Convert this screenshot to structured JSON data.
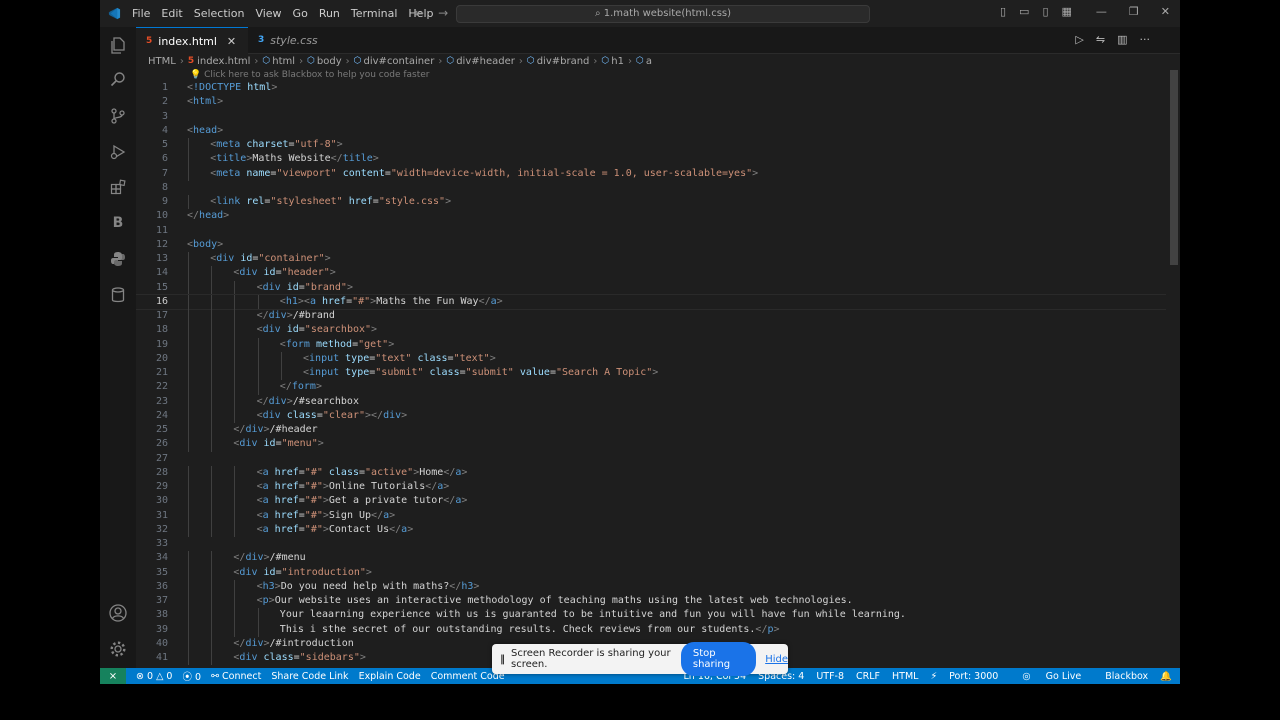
{
  "menus": [
    "File",
    "Edit",
    "Selection",
    "View",
    "Go",
    "Run",
    "Terminal",
    "Help"
  ],
  "search": {
    "text": "1.math website(html.css)"
  },
  "tabs": [
    {
      "label": "index.html",
      "icon": "html-file-icon",
      "active": true
    },
    {
      "label": "style.css",
      "icon": "css-file-icon",
      "active": false
    }
  ],
  "breadcrumb": [
    "HTML",
    "index.html",
    "html",
    "body",
    "div#container",
    "div#header",
    "div#brand",
    "h1",
    "a"
  ],
  "hint": "Click here to ask Blackbox to help you code faster",
  "activity_icons": [
    "explorer-icon",
    "search-icon",
    "source-control-icon",
    "run-debug-icon",
    "extensions-icon",
    "blackbox-icon",
    "python-icon",
    "database-icon",
    "account-icon",
    "settings-gear-icon"
  ],
  "activity_letter_b": "B",
  "code": [
    {
      "n": "1",
      "i": 0,
      "t": [
        [
          "br",
          "<"
        ],
        [
          "tag",
          "!DOCTYPE "
        ],
        [
          "at",
          "html"
        ],
        [
          "br",
          ">"
        ]
      ]
    },
    {
      "n": "2",
      "i": 0,
      "t": [
        [
          "br",
          "<"
        ],
        [
          "tag",
          "html"
        ],
        [
          "br",
          ">"
        ]
      ]
    },
    {
      "n": "3",
      "i": 0,
      "t": []
    },
    {
      "n": "4",
      "i": 0,
      "t": [
        [
          "br",
          "<"
        ],
        [
          "tag",
          "head"
        ],
        [
          "br",
          ">"
        ]
      ]
    },
    {
      "n": "5",
      "i": 1,
      "t": [
        [
          "br",
          "<"
        ],
        [
          "tag",
          "meta "
        ],
        [
          "at",
          "charset"
        ],
        [
          "tx",
          "="
        ],
        [
          "val",
          "\"utf-8\""
        ],
        [
          "br",
          ">"
        ]
      ]
    },
    {
      "n": "6",
      "i": 1,
      "t": [
        [
          "br",
          "<"
        ],
        [
          "tag",
          "title"
        ],
        [
          "br",
          ">"
        ],
        [
          "tx",
          "Maths Website"
        ],
        [
          "br",
          "</"
        ],
        [
          "tag",
          "title"
        ],
        [
          "br",
          ">"
        ]
      ]
    },
    {
      "n": "7",
      "i": 1,
      "t": [
        [
          "br",
          "<"
        ],
        [
          "tag",
          "meta "
        ],
        [
          "at",
          "name"
        ],
        [
          "tx",
          "="
        ],
        [
          "val",
          "\"viewport\""
        ],
        [
          "tx",
          " "
        ],
        [
          "at",
          "content"
        ],
        [
          "tx",
          "="
        ],
        [
          "val",
          "\"width=device-width, initial-scale = 1.0, user-scalable=yes\""
        ],
        [
          "br",
          ">"
        ]
      ]
    },
    {
      "n": "8",
      "i": 0,
      "t": []
    },
    {
      "n": "9",
      "i": 1,
      "t": [
        [
          "br",
          "<"
        ],
        [
          "tag",
          "link "
        ],
        [
          "at",
          "rel"
        ],
        [
          "tx",
          "="
        ],
        [
          "val",
          "\"stylesheet\""
        ],
        [
          "tx",
          " "
        ],
        [
          "at",
          "href"
        ],
        [
          "tx",
          "="
        ],
        [
          "val",
          "\"style.css\""
        ],
        [
          "br",
          ">"
        ]
      ]
    },
    {
      "n": "10",
      "i": 0,
      "t": [
        [
          "br",
          "</"
        ],
        [
          "tag",
          "head"
        ],
        [
          "br",
          ">"
        ]
      ]
    },
    {
      "n": "11",
      "i": 0,
      "t": []
    },
    {
      "n": "12",
      "i": 0,
      "t": [
        [
          "br",
          "<"
        ],
        [
          "tag",
          "body"
        ],
        [
          "br",
          ">"
        ]
      ]
    },
    {
      "n": "13",
      "i": 1,
      "t": [
        [
          "br",
          "<"
        ],
        [
          "tag",
          "div "
        ],
        [
          "at",
          "id"
        ],
        [
          "tx",
          "="
        ],
        [
          "val",
          "\"container\""
        ],
        [
          "br",
          ">"
        ]
      ]
    },
    {
      "n": "14",
      "i": 2,
      "t": [
        [
          "br",
          "<"
        ],
        [
          "tag",
          "div "
        ],
        [
          "at",
          "id"
        ],
        [
          "tx",
          "="
        ],
        [
          "val",
          "\"header\""
        ],
        [
          "br",
          ">"
        ]
      ]
    },
    {
      "n": "15",
      "i": 3,
      "t": [
        [
          "br",
          "<"
        ],
        [
          "tag",
          "div "
        ],
        [
          "at",
          "id"
        ],
        [
          "tx",
          "="
        ],
        [
          "val",
          "\"brand\""
        ],
        [
          "br",
          ">"
        ]
      ]
    },
    {
      "n": "16",
      "i": 4,
      "cur": true,
      "t": [
        [
          "br",
          "<"
        ],
        [
          "tag",
          "h1"
        ],
        [
          "br",
          ">"
        ],
        [
          "br",
          "<"
        ],
        [
          "tag",
          "a "
        ],
        [
          "at",
          "href"
        ],
        [
          "tx",
          "="
        ],
        [
          "val",
          "\"#\""
        ],
        [
          "br",
          ">"
        ],
        [
          "tx",
          "Maths the Fun Way"
        ],
        [
          "br",
          "</"
        ],
        [
          "tag",
          "a"
        ],
        [
          "br",
          ">"
        ]
      ]
    },
    {
      "n": "17",
      "i": 3,
      "t": [
        [
          "br",
          "</"
        ],
        [
          "tag",
          "div"
        ],
        [
          "br",
          ">"
        ],
        [
          "tx",
          "/#brand"
        ]
      ]
    },
    {
      "n": "18",
      "i": 3,
      "t": [
        [
          "br",
          "<"
        ],
        [
          "tag",
          "div "
        ],
        [
          "at",
          "id"
        ],
        [
          "tx",
          "="
        ],
        [
          "val",
          "\"searchbox\""
        ],
        [
          "br",
          ">"
        ]
      ]
    },
    {
      "n": "19",
      "i": 4,
      "t": [
        [
          "br",
          "<"
        ],
        [
          "tag",
          "form "
        ],
        [
          "at",
          "method"
        ],
        [
          "tx",
          "="
        ],
        [
          "val",
          "\"get\""
        ],
        [
          "br",
          ">"
        ]
      ]
    },
    {
      "n": "20",
      "i": 5,
      "t": [
        [
          "br",
          "<"
        ],
        [
          "tag",
          "input "
        ],
        [
          "at",
          "type"
        ],
        [
          "tx",
          "="
        ],
        [
          "val",
          "\"text\""
        ],
        [
          "tx",
          " "
        ],
        [
          "at",
          "class"
        ],
        [
          "tx",
          "="
        ],
        [
          "val",
          "\"text\""
        ],
        [
          "br",
          ">"
        ]
      ]
    },
    {
      "n": "21",
      "i": 5,
      "t": [
        [
          "br",
          "<"
        ],
        [
          "tag",
          "input "
        ],
        [
          "at",
          "type"
        ],
        [
          "tx",
          "="
        ],
        [
          "val",
          "\"submit\""
        ],
        [
          "tx",
          " "
        ],
        [
          "at",
          "class"
        ],
        [
          "tx",
          "="
        ],
        [
          "val",
          "\"submit\""
        ],
        [
          "tx",
          " "
        ],
        [
          "at",
          "value"
        ],
        [
          "tx",
          "="
        ],
        [
          "val",
          "\"Search A Topic\""
        ],
        [
          "br",
          ">"
        ]
      ]
    },
    {
      "n": "22",
      "i": 4,
      "t": [
        [
          "br",
          "</"
        ],
        [
          "tag",
          "form"
        ],
        [
          "br",
          ">"
        ]
      ]
    },
    {
      "n": "23",
      "i": 3,
      "t": [
        [
          "br",
          "</"
        ],
        [
          "tag",
          "div"
        ],
        [
          "br",
          ">"
        ],
        [
          "tx",
          "/#searchbox"
        ]
      ]
    },
    {
      "n": "24",
      "i": 3,
      "t": [
        [
          "br",
          "<"
        ],
        [
          "tag",
          "div "
        ],
        [
          "at",
          "class"
        ],
        [
          "tx",
          "="
        ],
        [
          "val",
          "\"clear\""
        ],
        [
          "br",
          "></"
        ],
        [
          "tag",
          "div"
        ],
        [
          "br",
          ">"
        ]
      ]
    },
    {
      "n": "25",
      "i": 2,
      "t": [
        [
          "br",
          "</"
        ],
        [
          "tag",
          "div"
        ],
        [
          "br",
          ">"
        ],
        [
          "tx",
          "/#header"
        ]
      ]
    },
    {
      "n": "26",
      "i": 2,
      "t": [
        [
          "br",
          "<"
        ],
        [
          "tag",
          "div "
        ],
        [
          "at",
          "id"
        ],
        [
          "tx",
          "="
        ],
        [
          "val",
          "\"menu\""
        ],
        [
          "br",
          ">"
        ]
      ]
    },
    {
      "n": "27",
      "i": 0,
      "t": []
    },
    {
      "n": "28",
      "i": 3,
      "t": [
        [
          "br",
          "<"
        ],
        [
          "tag",
          "a "
        ],
        [
          "at",
          "href"
        ],
        [
          "tx",
          "="
        ],
        [
          "val",
          "\"#\""
        ],
        [
          "tx",
          " "
        ],
        [
          "at",
          "class"
        ],
        [
          "tx",
          "="
        ],
        [
          "val",
          "\"active\""
        ],
        [
          "br",
          ">"
        ],
        [
          "tx",
          "Home"
        ],
        [
          "br",
          "</"
        ],
        [
          "tag",
          "a"
        ],
        [
          "br",
          ">"
        ]
      ]
    },
    {
      "n": "29",
      "i": 3,
      "t": [
        [
          "br",
          "<"
        ],
        [
          "tag",
          "a "
        ],
        [
          "at",
          "href"
        ],
        [
          "tx",
          "="
        ],
        [
          "val",
          "\"#\""
        ],
        [
          "br",
          ">"
        ],
        [
          "tx",
          "Online Tutorials"
        ],
        [
          "br",
          "</"
        ],
        [
          "tag",
          "a"
        ],
        [
          "br",
          ">"
        ]
      ]
    },
    {
      "n": "30",
      "i": 3,
      "t": [
        [
          "br",
          "<"
        ],
        [
          "tag",
          "a "
        ],
        [
          "at",
          "href"
        ],
        [
          "tx",
          "="
        ],
        [
          "val",
          "\"#\""
        ],
        [
          "br",
          ">"
        ],
        [
          "tx",
          "Get a private tutor"
        ],
        [
          "br",
          "</"
        ],
        [
          "tag",
          "a"
        ],
        [
          "br",
          ">"
        ]
      ]
    },
    {
      "n": "31",
      "i": 3,
      "t": [
        [
          "br",
          "<"
        ],
        [
          "tag",
          "a "
        ],
        [
          "at",
          "href"
        ],
        [
          "tx",
          "="
        ],
        [
          "val",
          "\"#\""
        ],
        [
          "br",
          ">"
        ],
        [
          "tx",
          "Sign Up"
        ],
        [
          "br",
          "</"
        ],
        [
          "tag",
          "a"
        ],
        [
          "br",
          ">"
        ]
      ]
    },
    {
      "n": "32",
      "i": 3,
      "t": [
        [
          "br",
          "<"
        ],
        [
          "tag",
          "a "
        ],
        [
          "at",
          "href"
        ],
        [
          "tx",
          "="
        ],
        [
          "val",
          "\"#\""
        ],
        [
          "br",
          ">"
        ],
        [
          "tx",
          "Contact Us"
        ],
        [
          "br",
          "</"
        ],
        [
          "tag",
          "a"
        ],
        [
          "br",
          ">"
        ]
      ]
    },
    {
      "n": "33",
      "i": 0,
      "t": []
    },
    {
      "n": "34",
      "i": 2,
      "t": [
        [
          "br",
          "</"
        ],
        [
          "tag",
          "div"
        ],
        [
          "br",
          ">"
        ],
        [
          "tx",
          "/#menu"
        ]
      ]
    },
    {
      "n": "35",
      "i": 2,
      "t": [
        [
          "br",
          "<"
        ],
        [
          "tag",
          "div "
        ],
        [
          "at",
          "id"
        ],
        [
          "tx",
          "="
        ],
        [
          "val",
          "\"introduction\""
        ],
        [
          "br",
          ">"
        ]
      ]
    },
    {
      "n": "36",
      "i": 3,
      "t": [
        [
          "br",
          "<"
        ],
        [
          "tag",
          "h3"
        ],
        [
          "br",
          ">"
        ],
        [
          "tx",
          "Do you need help with maths?"
        ],
        [
          "br",
          "</"
        ],
        [
          "tag",
          "h3"
        ],
        [
          "br",
          ">"
        ]
      ]
    },
    {
      "n": "37",
      "i": 3,
      "t": [
        [
          "br",
          "<"
        ],
        [
          "tag",
          "p"
        ],
        [
          "br",
          ">"
        ],
        [
          "tx",
          "Our website uses an interactive methodology of teaching maths using the latest web technologies."
        ]
      ]
    },
    {
      "n": "38",
      "i": 4,
      "t": [
        [
          "tx",
          "Your leaarning experience with us is guaranted to be intuitive and fun you will have fun while learning."
        ]
      ]
    },
    {
      "n": "39",
      "i": 4,
      "t": [
        [
          "tx",
          "This i sthe secret of our outstanding results. Check reviews from our students."
        ],
        [
          "br",
          "</"
        ],
        [
          "tag",
          "p"
        ],
        [
          "br",
          ">"
        ]
      ]
    },
    {
      "n": "40",
      "i": 2,
      "t": [
        [
          "br",
          "</"
        ],
        [
          "tag",
          "div"
        ],
        [
          "br",
          ">"
        ],
        [
          "tx",
          "/#introduction"
        ]
      ]
    },
    {
      "n": "41",
      "i": 2,
      "t": [
        [
          "br",
          "<"
        ],
        [
          "tag",
          "div "
        ],
        [
          "at",
          "class"
        ],
        [
          "tx",
          "="
        ],
        [
          "val",
          "\"sidebars\""
        ],
        [
          "br",
          ">"
        ]
      ]
    }
  ],
  "status": {
    "problems_errors": "0",
    "problems_warnings": "0",
    "ports": "0",
    "left_items": [
      "Connect",
      "Share Code Link",
      "Explain Code",
      "Comment Code"
    ],
    "right_items": [
      "Ln 16, Col 54",
      "Spaces: 4",
      "UTF-8",
      "CRLF",
      "HTML",
      "Port: 3000",
      "Go Live",
      "Blackbox"
    ]
  },
  "share_popup": {
    "message": "Screen Recorder is sharing your screen.",
    "stop_label": "Stop sharing",
    "hide_label": "Hide"
  },
  "colors": {
    "accent": "#007acc",
    "remote": "#16825d",
    "tag": "#569cd6",
    "attr": "#9cdcfe",
    "value": "#ce9178",
    "text": "#d4d4d4"
  }
}
